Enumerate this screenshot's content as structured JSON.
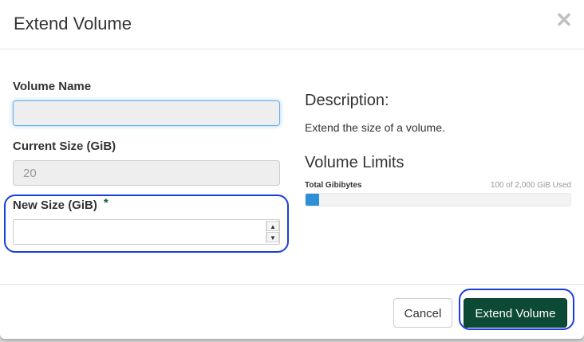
{
  "modal": {
    "title": "Extend Volume",
    "close_glyph": "✕"
  },
  "form": {
    "volume_name": {
      "label": "Volume Name",
      "value": ""
    },
    "current_size": {
      "label": "Current Size (GiB)",
      "value": "20"
    },
    "new_size": {
      "label": "New Size (GiB)",
      "required_mark": "*",
      "value": ""
    }
  },
  "description": {
    "heading": "Description:",
    "text": "Extend the size of a volume."
  },
  "limits": {
    "heading": "Volume Limits",
    "quota_label": "Total Gibibytes",
    "quota_used_text": "100 of 2,000 GiB Used",
    "used_fraction": 0.05
  },
  "footer": {
    "cancel_label": "Cancel",
    "submit_label": "Extend Volume"
  },
  "colors": {
    "primary": "#0d4a35",
    "progress": "#2d8fd6",
    "highlight": "#1a3fd6"
  },
  "icons": {
    "close": "close-icon",
    "spin_up": "chevron-up-icon",
    "spin_down": "chevron-down-icon"
  }
}
